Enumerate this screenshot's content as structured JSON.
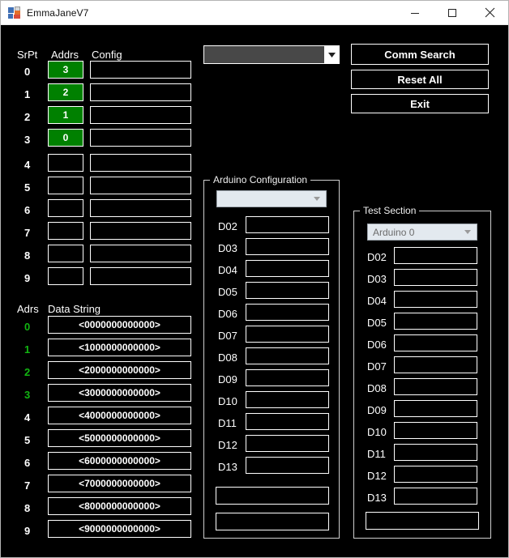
{
  "window": {
    "title": "EmmaJaneV7",
    "icon": "app-icon",
    "minimize_label": "─",
    "maximize_label": "□",
    "close_label": "✕",
    "background": "#000000",
    "titlebar_background": "#ffffff"
  },
  "colors": {
    "panel_background": "#000000",
    "field_border": "#ffffff",
    "field_text": "#ffffff",
    "addr_box_fill": "#008000",
    "addr_label_green": "#12b512",
    "combo_dark_fill": "#484848",
    "combo_light_fill": "#e3e9ef",
    "groupbox_border": "#cfcfcf"
  },
  "srpt_table": {
    "headers": {
      "srpt": "SrPt",
      "addrs": "Addrs",
      "config": "Config"
    },
    "rows": [
      {
        "srpt": "0",
        "addrs": "3",
        "addrs_active": true,
        "config": ""
      },
      {
        "srpt": "1",
        "addrs": "2",
        "addrs_active": true,
        "config": ""
      },
      {
        "srpt": "2",
        "addrs": "1",
        "addrs_active": true,
        "config": ""
      },
      {
        "srpt": "3",
        "addrs": "0",
        "addrs_active": true,
        "config": ""
      },
      {
        "srpt": "4",
        "addrs": "",
        "addrs_active": false,
        "config": ""
      },
      {
        "srpt": "5",
        "addrs": "",
        "addrs_active": false,
        "config": ""
      },
      {
        "srpt": "6",
        "addrs": "",
        "addrs_active": false,
        "config": ""
      },
      {
        "srpt": "7",
        "addrs": "",
        "addrs_active": false,
        "config": ""
      },
      {
        "srpt": "8",
        "addrs": "",
        "addrs_active": false,
        "config": ""
      },
      {
        "srpt": "9",
        "addrs": "",
        "addrs_active": false,
        "config": ""
      }
    ]
  },
  "data_string_table": {
    "headers": {
      "adrs": "Adrs",
      "data_string": "Data String"
    },
    "rows": [
      {
        "adrs": "0",
        "adrs_green": true,
        "value": "<0000000000000>"
      },
      {
        "adrs": "1",
        "adrs_green": true,
        "value": "<1000000000000>"
      },
      {
        "adrs": "2",
        "adrs_green": true,
        "value": "<2000000000000>"
      },
      {
        "adrs": "3",
        "adrs_green": true,
        "value": "<3000000000000>"
      },
      {
        "adrs": "4",
        "adrs_green": false,
        "value": "<4000000000000>"
      },
      {
        "adrs": "5",
        "adrs_green": false,
        "value": "<5000000000000>"
      },
      {
        "adrs": "6",
        "adrs_green": false,
        "value": "<6000000000000>"
      },
      {
        "adrs": "7",
        "adrs_green": false,
        "value": "<7000000000000>"
      },
      {
        "adrs": "8",
        "adrs_green": false,
        "value": "<8000000000000>"
      },
      {
        "adrs": "9",
        "adrs_green": false,
        "value": "<9000000000000>"
      }
    ]
  },
  "port_combo": {
    "value": "",
    "arrow_icon": "chevron-down-icon"
  },
  "action_buttons": {
    "comm_search": "Comm Search",
    "reset_all": "Reset All",
    "exit": "Exit"
  },
  "arduino_configuration": {
    "title": "Arduino Configuration",
    "combo": {
      "value": "",
      "arrow_icon": "chevron-down-icon"
    },
    "pins": [
      {
        "label": "D02",
        "value": ""
      },
      {
        "label": "D03",
        "value": ""
      },
      {
        "label": "D04",
        "value": ""
      },
      {
        "label": "D05",
        "value": ""
      },
      {
        "label": "D06",
        "value": ""
      },
      {
        "label": "D07",
        "value": ""
      },
      {
        "label": "D08",
        "value": ""
      },
      {
        "label": "D09",
        "value": ""
      },
      {
        "label": "D10",
        "value": ""
      },
      {
        "label": "D11",
        "value": ""
      },
      {
        "label": "D12",
        "value": ""
      },
      {
        "label": "D13",
        "value": ""
      }
    ],
    "extra_fields": [
      {
        "value": ""
      },
      {
        "value": ""
      }
    ]
  },
  "test_section": {
    "title": "Test Section",
    "combo": {
      "value": "Arduino 0",
      "arrow_icon": "chevron-down-icon"
    },
    "pins": [
      {
        "label": "D02",
        "value": ""
      },
      {
        "label": "D03",
        "value": ""
      },
      {
        "label": "D04",
        "value": ""
      },
      {
        "label": "D05",
        "value": ""
      },
      {
        "label": "D06",
        "value": ""
      },
      {
        "label": "D07",
        "value": ""
      },
      {
        "label": "D08",
        "value": ""
      },
      {
        "label": "D09",
        "value": ""
      },
      {
        "label": "D10",
        "value": ""
      },
      {
        "label": "D11",
        "value": ""
      },
      {
        "label": "D12",
        "value": ""
      },
      {
        "label": "D13",
        "value": ""
      }
    ],
    "extra_fields": [
      {
        "value": ""
      }
    ]
  }
}
